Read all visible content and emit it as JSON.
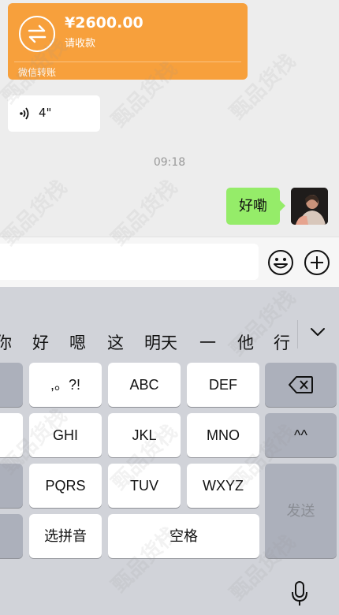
{
  "chat": {
    "transfer": {
      "amount": "¥2600.00",
      "subtitle": "请收款",
      "footer": "微信转账"
    },
    "voice": {
      "duration": "4\""
    },
    "timestamp": "09:18",
    "outgoing_message": "好嘞"
  },
  "keyboard": {
    "candidates": [
      "你",
      "好",
      "嗯",
      "这",
      "明天",
      "一",
      "他",
      "行"
    ],
    "keys": {
      "punct": ",。?!",
      "abc": "ABC",
      "def": "DEF",
      "ghi": "GHI",
      "jkl": "JKL",
      "mno": "MNO",
      "pqrs": "PQRS",
      "tuv": "TUV",
      "wxyz": "WXYZ",
      "pinyin": "选拼音",
      "space": "空格",
      "send": "发送",
      "emoticon": "^^",
      "left_partial": "…"
    }
  },
  "watermark": "甄品货栈",
  "colors": {
    "transfer": "#f7a03c",
    "outgoing_bubble": "#95ec69",
    "chat_bg": "#ededed",
    "keyboard_bg": "#d1d3d9"
  }
}
